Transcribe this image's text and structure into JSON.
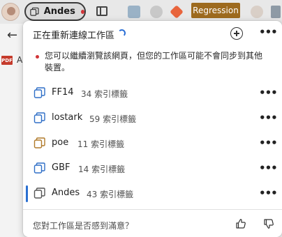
{
  "browser": {
    "workspace_pill_label": "Andes",
    "bookmark_chip_label": "Regression",
    "bg_tab_letter": "A",
    "pdf_badge_label": "PDF"
  },
  "popup": {
    "title": "正在重新連線工作區",
    "warning": "您可以繼續瀏覽該網頁，但您的工作區可能不會同步到其他裝置。",
    "workspaces": [
      {
        "name": "FF14",
        "count": "34 索引標籤",
        "icon_color": "#2f6fc7",
        "selected": false
      },
      {
        "name": "lostark",
        "count": "59 索引標籤",
        "icon_color": "#2f6fc7",
        "selected": false
      },
      {
        "name": "poe",
        "count": "11 索引標籤",
        "icon_color": "#b07a2a",
        "selected": false
      },
      {
        "name": "GBF",
        "count": "14 索引標籤",
        "icon_color": "#2f6fc7",
        "selected": false
      },
      {
        "name": "Andes",
        "count": "43 索引標籤",
        "icon_color": "#555555",
        "selected": true
      }
    ],
    "feedback": "您對工作區是否感到滿意？"
  },
  "colors": {
    "accent": "#2a6fd1",
    "warning_dot": "#d13438",
    "bookmark_chip": "#9d6a1e"
  }
}
